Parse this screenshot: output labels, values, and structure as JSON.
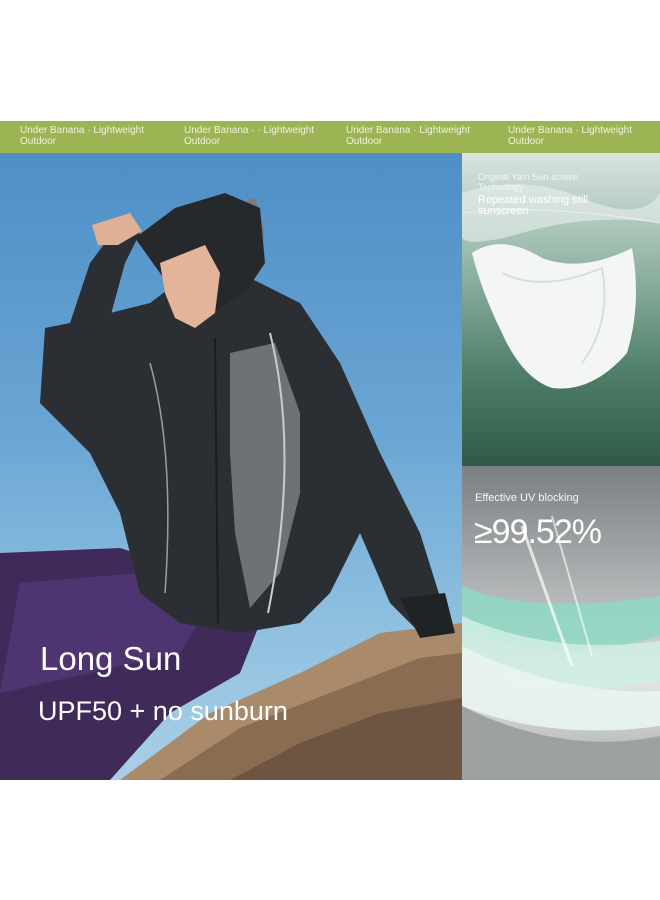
{
  "banner": {
    "items": [
      {
        "brand": "Under Banana · Lightweight",
        "tag": "Outdoor"
      },
      {
        "brand": "Under Banana · · Lightweight",
        "tag": "Outdoor"
      },
      {
        "brand": "Under Banana · Lightweight",
        "tag": "Outdoor"
      },
      {
        "brand": "Under Banana · Lightweight",
        "tag": "Outdoor"
      }
    ]
  },
  "hero": {
    "title": "Long Sun",
    "subtitle": "UPF50 + no sunburn"
  },
  "tech_panel": {
    "caption": "Original Yarn Sun-screen Technology",
    "headline": "Repeated washing still sunscreen"
  },
  "uv_panel": {
    "label": "Effective UV blocking",
    "value": "≥99.52%"
  },
  "colors": {
    "banner": "#9db455",
    "sky": "#6aa6d4",
    "jacket": "#2b2f33",
    "pants": "#3f2a5a",
    "fabric_accent": "#8fd8c3"
  }
}
